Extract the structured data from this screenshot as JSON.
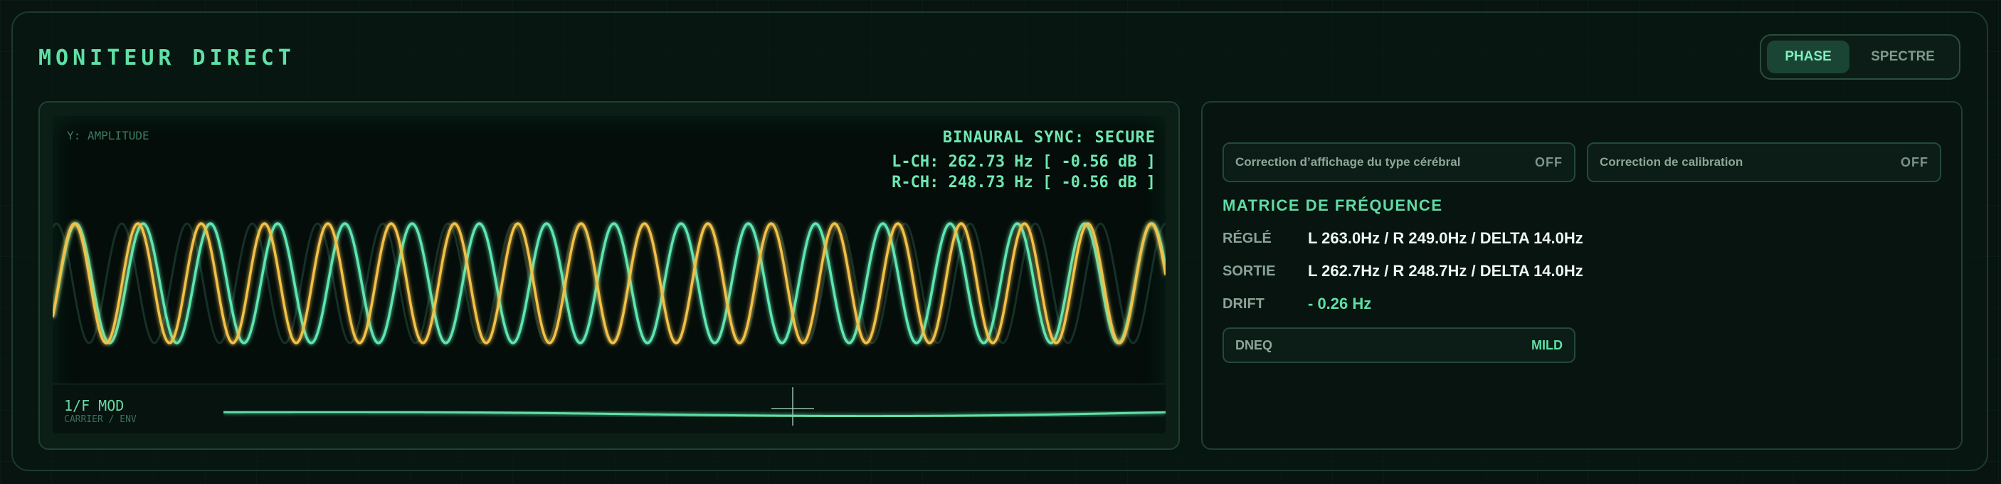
{
  "header": {
    "title": "MONITEUR DIRECT"
  },
  "mode_toggle": {
    "active": "PHASE",
    "inactive": "SPECTRE"
  },
  "scope": {
    "y_label": "Y: AMPLITUDE",
    "sync_status": "BINAURAL SYNC: SECURE",
    "left_channel": "L-CH: 262.73 Hz [ -0.56 dB ]",
    "right_channel": "R-CH: 248.73 Hz [ -0.56 dB ]",
    "left_color": "#f2c14a",
    "right_color": "#5fe6b0",
    "mod_title": "1/F MOD",
    "mod_subtitle": "CARRIER / ENV"
  },
  "corrections": [
    {
      "label": "Correction d’affichage du type cérébral",
      "state": "OFF"
    },
    {
      "label": "Correction de calibration",
      "state": "OFF"
    }
  ],
  "matrix": {
    "title": "MATRICE DE FRÉQUENCE",
    "rows": [
      {
        "key": "RÉGLÉ",
        "value": "L 263.0Hz / R 249.0Hz / DELTA 14.0Hz"
      },
      {
        "key": "SORTIE",
        "value": "L 262.7Hz / R 248.7Hz / DELTA 14.0Hz"
      },
      {
        "key": "DRIFT",
        "value": "- 0.26 Hz"
      }
    ]
  },
  "dneq": {
    "label": "DNEQ",
    "value": "MILD"
  }
}
